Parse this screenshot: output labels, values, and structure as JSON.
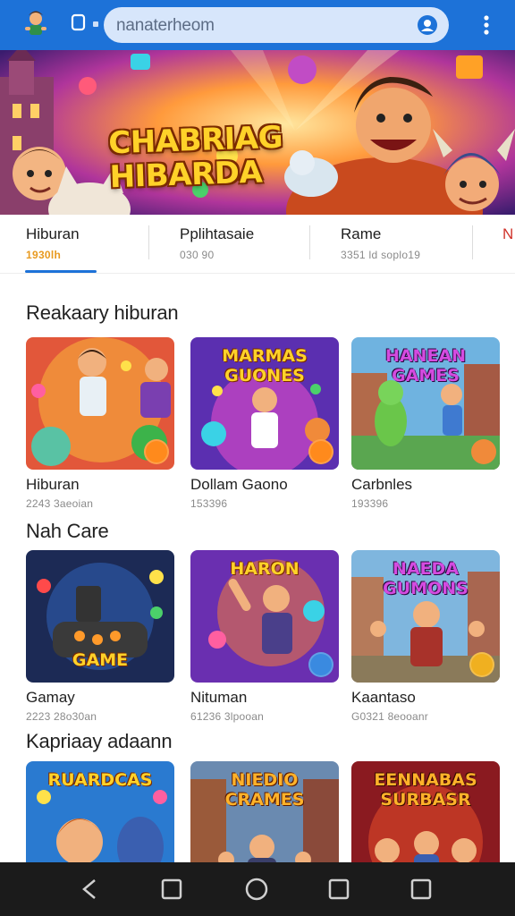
{
  "browser": {
    "app_icon": "game-app-icon",
    "url": "nanaterheom",
    "colors": {
      "bar": "#1d72d8",
      "url_bg": "#d7e6fb"
    }
  },
  "hero": {
    "title_line1": "CHABRIAG",
    "title_line2": "HIBARDA"
  },
  "tabs": [
    {
      "label": "Hiburan",
      "sub": "1930lh"
    },
    {
      "label": "Pplihtasaie",
      "sub": "030 90"
    },
    {
      "label": "Rame",
      "sub": "3351 ld soplo19"
    },
    {
      "label": "N",
      "sub": ""
    }
  ],
  "sections": [
    {
      "title": "Reakaary hiburan",
      "cards": [
        {
          "title": "Hiburan",
          "meta": "2243 3aeoian",
          "thumb_text": ""
        },
        {
          "title": "Dollam Gaono",
          "meta": "153396",
          "thumb_text": "MARMAS GUONES"
        },
        {
          "title": "Carbnles",
          "meta": "193396",
          "thumb_text": "HANEAN GAMES"
        }
      ]
    },
    {
      "title": "Nah Care",
      "cards": [
        {
          "title": "Gamay",
          "meta": "2223 28o30an",
          "thumb_text": "GAME"
        },
        {
          "title": "Nituman",
          "meta": "61236 3lpooan",
          "thumb_text": "HARON"
        },
        {
          "title": "Kaantaso",
          "meta": "G0321 8eooanr",
          "thumb_text": "NAEDA GUMONS"
        }
      ]
    },
    {
      "title": "Kapriaay adaann",
      "cards": [
        {
          "title": "",
          "meta": "",
          "thumb_text": "RUARDCAS"
        },
        {
          "title": "",
          "meta": "",
          "thumb_text": "NIEDIO CRAMES"
        },
        {
          "title": "",
          "meta": "",
          "thumb_text": "EENNABAS SURBASR"
        }
      ]
    }
  ],
  "navbar": {
    "buttons": [
      "back-icon",
      "square-icon",
      "home-circle-icon",
      "recents-square-icon",
      "square-icon"
    ]
  }
}
